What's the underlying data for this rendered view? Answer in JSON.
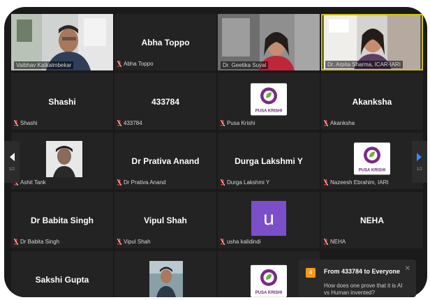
{
  "participants": [
    {
      "id": "vs",
      "label": "Vaibhav Katkalmbekar"
    },
    {
      "id": "at",
      "label": "Abha Toppo",
      "center": "Abha Toppo"
    },
    {
      "id": "gs",
      "label": "Dr. Geetika Suyal"
    },
    {
      "id": "as",
      "label": "Dr. Arpita Sharma, ICAR-IARI"
    },
    {
      "id": "sh",
      "label": "Shashi",
      "center": "Shashi"
    },
    {
      "id": "n4",
      "label": "433784",
      "center": "433784"
    },
    {
      "id": "pk",
      "label": "Pusa Krishi"
    },
    {
      "id": "ak",
      "label": "Akanksha",
      "center": "Akanksha"
    },
    {
      "id": "ash",
      "label": "Ashit Tank"
    },
    {
      "id": "pa",
      "label": "Dr Prativa Anand",
      "center": "Dr Prativa Anand"
    },
    {
      "id": "dl",
      "label": "Durga Lakshmi Y",
      "center": "Durga Lakshmi Y"
    },
    {
      "id": "ne",
      "label": "Nazeesh Ebrahim, IARI"
    },
    {
      "id": "bs",
      "label": "Dr Babita Singh",
      "center": "Dr Babita Singh"
    },
    {
      "id": "vp",
      "label": "Vipul Shah",
      "center": "Vipul Shah"
    },
    {
      "id": "uk",
      "label": "usha kalidindi",
      "avatar_letter": "u"
    },
    {
      "id": "nh",
      "label": "NEHA",
      "center": "NEHA"
    },
    {
      "id": "sg",
      "center": "Sakshi Gupta"
    }
  ],
  "logo": {
    "text": "PUSA KRISHI"
  },
  "nav": {
    "prev_page": "1/2",
    "next_page": "1/2"
  },
  "chat": {
    "badge": "4",
    "title": "From 433784 to Everyone",
    "message": "How does one prove that it is AI vs Human invented?",
    "close": "×"
  },
  "colors": {
    "background": "#1a1a1a",
    "tile": "#232323",
    "muted_mic": "#e53935",
    "avatar": "#7b4fc9",
    "chat_badge": "#f29b1c",
    "next_arrow": "#2d8cff"
  }
}
